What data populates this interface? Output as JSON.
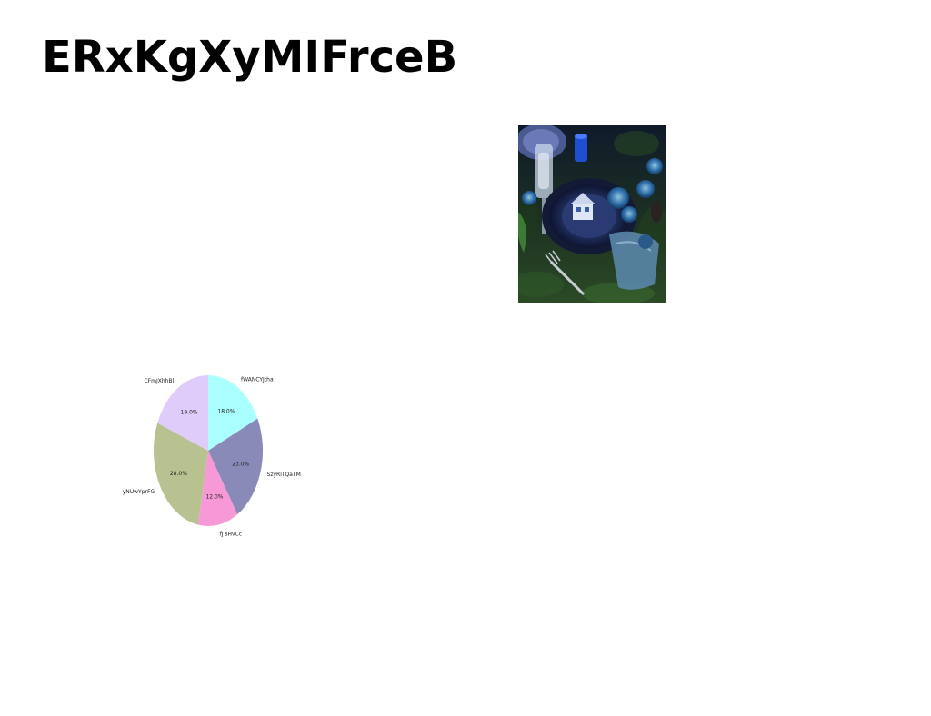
{
  "page": {
    "title": "ERxKgXyMIFrceB"
  },
  "photo": {
    "icon": "table-setting-photo"
  },
  "chart_data": {
    "type": "pie",
    "title": "",
    "slices": [
      {
        "label": "fWANCYJtha",
        "value": 18.0,
        "pct_label": "18.0%",
        "color": "#aaffff"
      },
      {
        "label": "SzyRlTQaTM",
        "value": 23.0,
        "pct_label": "23.0%",
        "color": "#8a8ab8"
      },
      {
        "label": "fJ sHvCc",
        "value": 12.0,
        "pct_label": "12.0%",
        "color": "#f799d6"
      },
      {
        "label": "yNUwYprFG",
        "value": 28.0,
        "pct_label": "28.0%",
        "color": "#b8c290"
      },
      {
        "label": "CFmJXhhBl",
        "value": 19.0,
        "pct_label": "19.0%",
        "color": "#e0ccfa"
      }
    ],
    "start_angle": "top",
    "direction": "clockwise"
  }
}
